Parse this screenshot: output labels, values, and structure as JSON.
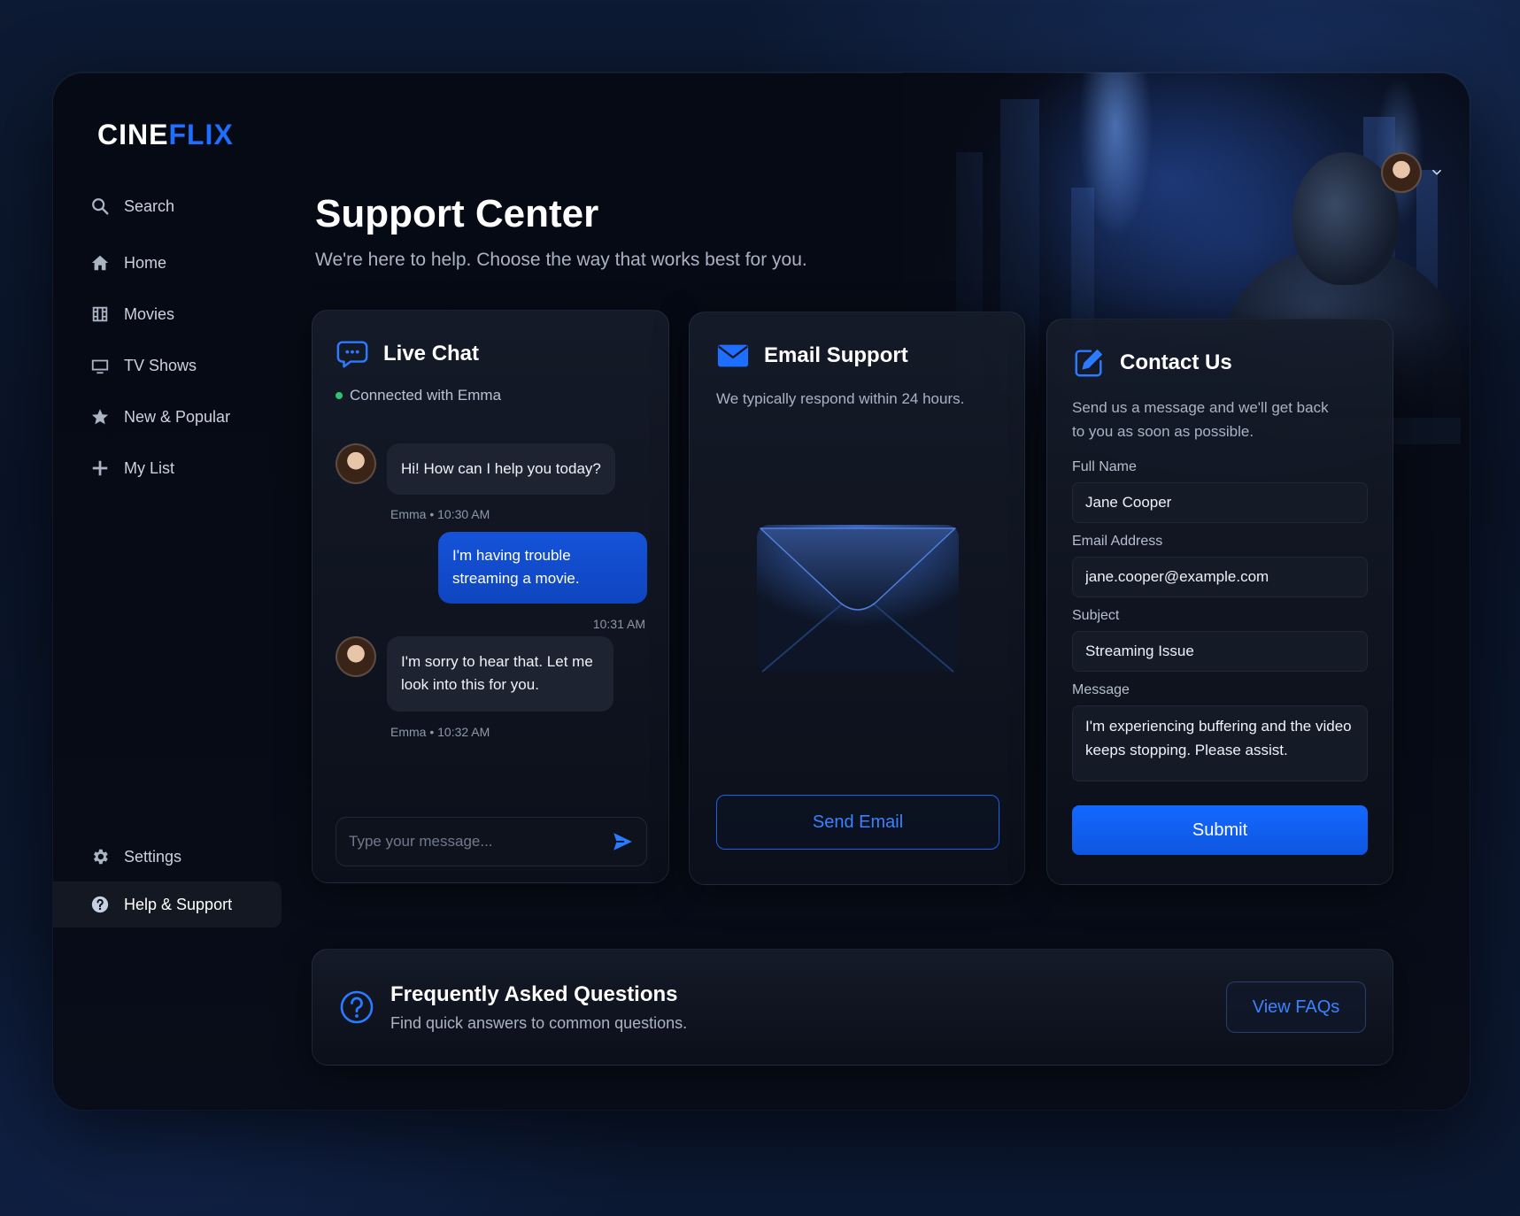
{
  "brand": {
    "name_part1": "CINE",
    "name_part2": "FLIX",
    "accent_color": "#1e6fff"
  },
  "sidebar": {
    "items": [
      {
        "label": "Search",
        "icon": "search-icon"
      },
      {
        "label": "Home",
        "icon": "home-icon"
      },
      {
        "label": "Movies",
        "icon": "film-icon"
      },
      {
        "label": "TV Shows",
        "icon": "tv-icon"
      },
      {
        "label": "New & Popular",
        "icon": "star-icon"
      },
      {
        "label": "My List",
        "icon": "plus-icon"
      }
    ],
    "bottom_items": [
      {
        "label": "Settings",
        "icon": "gear-icon"
      },
      {
        "label": "Help & Support",
        "icon": "help-icon",
        "active": true
      }
    ]
  },
  "header": {
    "title": "Support Center",
    "subtitle": "We're here to help. Choose the way that works best for you."
  },
  "live_chat": {
    "title": "Live Chat",
    "status": "Connected with Emma",
    "status_color": "#2ec46d",
    "messages": [
      {
        "from": "agent",
        "text": "Hi! How can I help you today?",
        "meta": "Emma • 10:30 AM"
      },
      {
        "from": "user",
        "text": "I'm having trouble streaming a movie.",
        "meta": "10:31 AM"
      },
      {
        "from": "agent",
        "text": "I'm sorry to hear that. Let me look into this for you.",
        "meta": "Emma • 10:32 AM"
      }
    ],
    "input_placeholder": "Type your message..."
  },
  "email_support": {
    "title": "Email Support",
    "subtitle": "We typically respond within 24 hours.",
    "button_label": "Send Email"
  },
  "contact_us": {
    "title": "Contact Us",
    "subtitle": "Send us a message and we'll get back to you as soon as possible.",
    "fields": {
      "full_name": {
        "label": "Full Name",
        "value": "Jane Cooper"
      },
      "email": {
        "label": "Email Address",
        "value": "jane.cooper@example.com"
      },
      "subject": {
        "label": "Subject",
        "value": "Streaming Issue"
      },
      "message": {
        "label": "Message",
        "value": "I'm experiencing buffering and the video keeps stopping. Please assist."
      }
    },
    "submit_label": "Submit"
  },
  "faq": {
    "title": "Frequently Asked Questions",
    "subtitle": "Find quick answers to common questions.",
    "button_label": "View FAQs"
  }
}
